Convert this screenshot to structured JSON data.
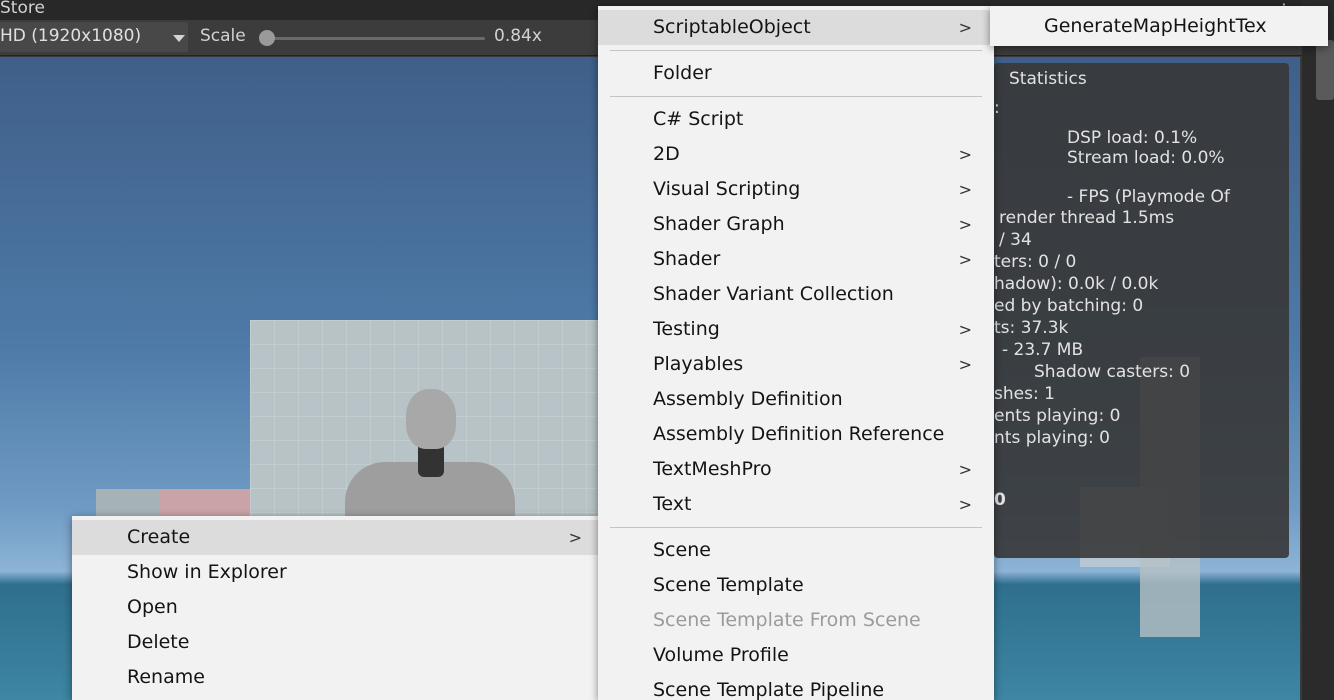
{
  "window": {
    "title": "Store"
  },
  "toolbar": {
    "resolution": "HD (1920x1080)",
    "scale_label": "Scale",
    "scale_value": "0.84x",
    "scale_fraction": 0.02
  },
  "context_menu": {
    "items": [
      {
        "label": "Create",
        "has_submenu": true
      },
      {
        "label": "Show in Explorer"
      },
      {
        "label": "Open"
      },
      {
        "label": "Delete"
      },
      {
        "label": "Rename"
      }
    ]
  },
  "create_menu": {
    "items": [
      "ScriptableObject",
      "Folder",
      "C# Script",
      "2D",
      "Visual Scripting",
      "Shader Graph",
      "Shader",
      "Shader Variant Collection",
      "Testing",
      "Playables",
      "Assembly Definition",
      "Assembly Definition Reference",
      "TextMeshPro",
      "Text",
      "Scene",
      "Scene Template",
      "Scene Template From Scene",
      "Volume Profile",
      "Scene Template Pipeline"
    ]
  },
  "submenu": {
    "item": "GenerateMapHeightTex"
  },
  "statistics": {
    "title": "Statistics",
    "lines": [
      "DSP load: 0.1%",
      "Stream load: 0.0%",
      "- FPS (Playmode Of",
      "render thread 1.5ms",
      "/ 34",
      "ters: 0 / 0",
      "hadow): 0.0k / 0.0k",
      "ed by batching: 0",
      "ts: 37.3k",
      "- 23.7 MB",
      "Shadow casters: 0",
      "shes: 1",
      "ents playing: 0",
      "nts playing: 0",
      "0"
    ]
  }
}
